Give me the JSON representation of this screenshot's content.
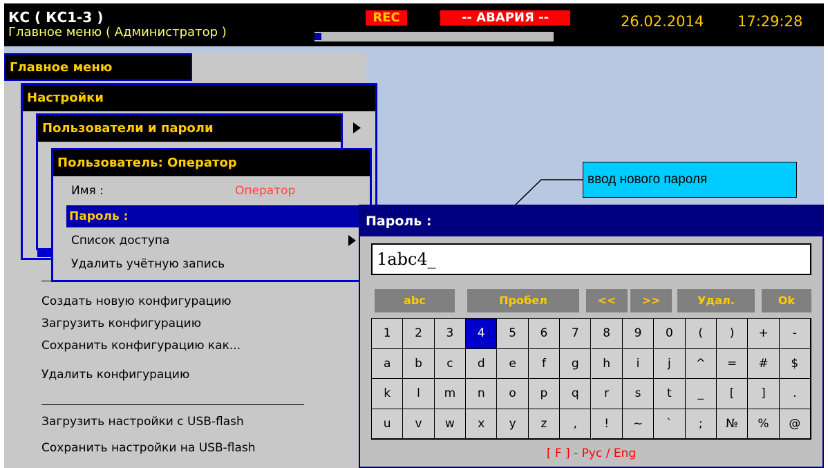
{
  "header": {
    "title": "КС ( КС1-3 )",
    "subtitle": "Главное меню ( Администратор )",
    "rec_badge": "REC",
    "alarm_badge": "-- АВАРИЯ --",
    "date": "26.02.2014",
    "time": "17:29:28",
    "progress": 0.03
  },
  "main_menu": {
    "title": "Главное меню",
    "items": [
      "Создать новую конфигурацию",
      "Загрузить конфигурацию",
      "Сохранить конфигурацию как...",
      "Удалить конфигурацию",
      "Загрузить настройки с USB-flash",
      "Сохранить настройки на USB-flash"
    ]
  },
  "settings_menu": {
    "title": "Настройки"
  },
  "users_menu": {
    "title": "Пользователи и пароли"
  },
  "user_menu": {
    "title": "Пользователь: Оператор",
    "name_label": "Имя :",
    "name_value": "Оператор",
    "password_label": "Пароль :",
    "access_label": "Список доступа",
    "delete_label": "Удалить учётную запись"
  },
  "callout": {
    "text": "ввод нового пароля"
  },
  "password_dialog": {
    "title": "Пароль :",
    "value": "1abc4_",
    "func_keys": [
      "abc",
      "Пробел",
      "<<",
      ">>",
      "Удал.",
      "Ok"
    ],
    "rows": [
      [
        "1",
        "2",
        "3",
        "4",
        "5",
        "6",
        "7",
        "8",
        "9",
        "0",
        "(",
        ")",
        "+",
        "-"
      ],
      [
        "a",
        "b",
        "c",
        "d",
        "e",
        "f",
        "g",
        "h",
        "i",
        "j",
        "^",
        "=",
        "#",
        "$"
      ],
      [
        "k",
        "l",
        "m",
        "n",
        "o",
        "p",
        "q",
        "r",
        "s",
        "t",
        "_",
        "[",
        "]",
        "."
      ],
      [
        "u",
        "v",
        "w",
        "x",
        "y",
        "z",
        ",",
        "!",
        "~",
        "`",
        ";",
        "№",
        "%",
        "@"
      ]
    ],
    "selected_key": "4",
    "footer": "[ F ] - Рус / Eng"
  }
}
